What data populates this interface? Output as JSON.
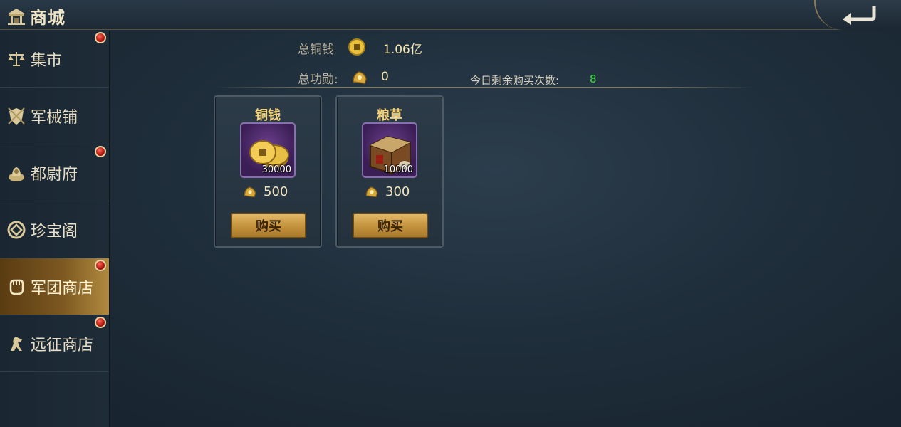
{
  "header": {
    "title": "商城",
    "back_icon": "back-arrow-icon"
  },
  "sidebar": {
    "items": [
      {
        "label": "集市",
        "icon": "scale-icon",
        "badge": true,
        "active": false
      },
      {
        "label": "军械铺",
        "icon": "shield-icon",
        "badge": false,
        "active": false
      },
      {
        "label": "都尉府",
        "icon": "seal-icon",
        "badge": true,
        "active": false
      },
      {
        "label": "珍宝阁",
        "icon": "coin-icon",
        "badge": false,
        "active": false
      },
      {
        "label": "军团商店",
        "icon": "fist-icon",
        "badge": true,
        "active": true
      },
      {
        "label": "远征商店",
        "icon": "horse-icon",
        "badge": true,
        "active": false
      }
    ]
  },
  "stats": {
    "copper_label": "总铜钱",
    "copper_value": "1.06亿",
    "merit_label": "总功勋:",
    "merit_value": "0",
    "remaining_label": "今日剩余购买次数:",
    "remaining_value": "8"
  },
  "items": [
    {
      "name": "铜钱",
      "qty": "30000",
      "price": "500",
      "buy_label": "购买",
      "icon": "copper-coins-icon"
    },
    {
      "name": "粮草",
      "qty": "10000",
      "price": "300",
      "buy_label": "购买",
      "icon": "supply-crate-icon"
    }
  ],
  "colors": {
    "accent": "#f3d27a",
    "remaining": "#3fdc3f",
    "active_tab": "#7a5620"
  }
}
